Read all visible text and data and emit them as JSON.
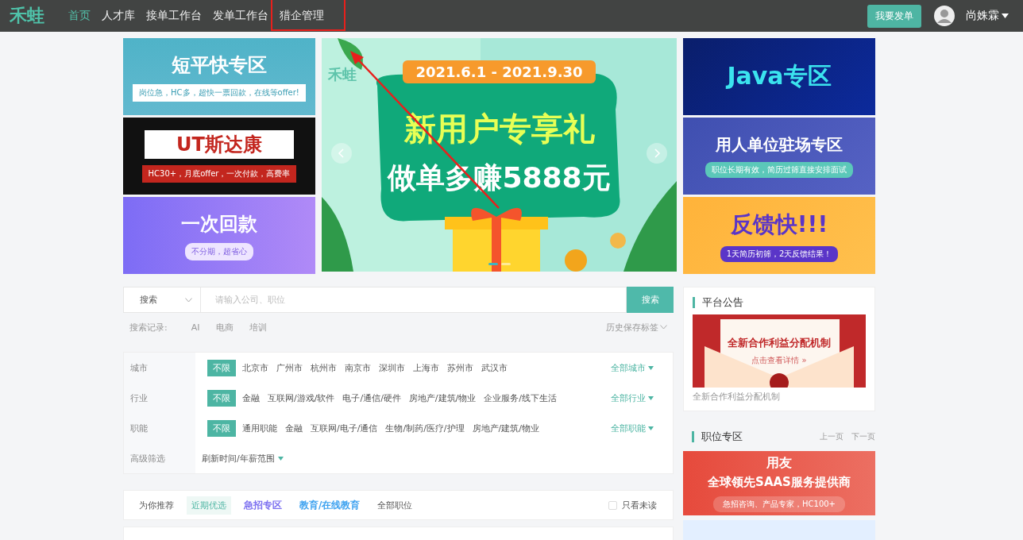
{
  "nav": {
    "logo": "禾蛙",
    "items": [
      {
        "label": "首页",
        "selected": true,
        "annotated": false
      },
      {
        "label": "人才库",
        "selected": false,
        "annotated": false
      },
      {
        "label": "接单工作台",
        "selected": false,
        "annotated": false
      },
      {
        "label": "发单工作台",
        "selected": false,
        "annotated": false
      },
      {
        "label": "猎企管理",
        "selected": false,
        "annotated": true
      }
    ],
    "post_button": "我要发单",
    "user": "尚姝霖"
  },
  "left_banners": [
    {
      "kind": "duanpingkuai",
      "title": "短平快专区",
      "subtitle": "岗位急，HC多，超快一票回款，在线等offer!"
    },
    {
      "kind": "utstarcom",
      "title": "UT斯达康",
      "subtitle": "HC30+，月底offer，一次付款，高费率"
    },
    {
      "kind": "payment",
      "title": "一次回款",
      "subtitle": "不分期，超省心"
    }
  ],
  "carousel": {
    "logo": "禾蛙",
    "date": "2021.6.1 - 2021.9.30",
    "line1": "新用户专享礼",
    "line2": "做单多赚5888元",
    "dots": [
      {
        "selected": true
      },
      {
        "selected": false
      }
    ]
  },
  "right_banners": [
    {
      "kind": "java",
      "title": "Java专区"
    },
    {
      "kind": "onsite",
      "title": "用人单位驻场专区",
      "subtitle": "职位长期有效，简历过筛直接安排面试"
    },
    {
      "kind": "feedback",
      "title": "反馈快!!!",
      "subtitle": "1天简历初筛，2天反馈结果！"
    }
  ],
  "search": {
    "scope": "搜索",
    "placeholder": "请输入公司、职位",
    "button": "搜索"
  },
  "history": {
    "label": "搜索记录:",
    "tags": [
      "AI",
      "电商",
      "培训"
    ],
    "saved": "历史保存标签"
  },
  "filters": [
    {
      "label": "城市",
      "options": [
        {
          "label": "不限",
          "selected": true
        },
        {
          "label": "北京市",
          "selected": false
        },
        {
          "label": "广州市",
          "selected": false
        },
        {
          "label": "杭州市",
          "selected": false
        },
        {
          "label": "南京市",
          "selected": false
        },
        {
          "label": "深圳市",
          "selected": false
        },
        {
          "label": "上海市",
          "selected": false
        },
        {
          "label": "苏州市",
          "selected": false
        },
        {
          "label": "武汉市",
          "selected": false
        }
      ],
      "more": "全部城市"
    },
    {
      "label": "行业",
      "options": [
        {
          "label": "不限",
          "selected": true
        },
        {
          "label": "金融",
          "selected": false
        },
        {
          "label": "互联网/游戏/软件",
          "selected": false
        },
        {
          "label": "电子/通信/硬件",
          "selected": false
        },
        {
          "label": "房地产/建筑/物业",
          "selected": false
        },
        {
          "label": "企业服务/线下生活",
          "selected": false
        }
      ],
      "more": "全部行业"
    },
    {
      "label": "职能",
      "options": [
        {
          "label": "不限",
          "selected": true
        },
        {
          "label": "通用职能",
          "selected": false
        },
        {
          "label": "金融",
          "selected": false
        },
        {
          "label": "互联网/电子/通信",
          "selected": false
        },
        {
          "label": "生物/制药/医疗/护理",
          "selected": false
        },
        {
          "label": "房地产/建筑/物业",
          "selected": false
        }
      ],
      "more": "全部职能"
    }
  ],
  "advanced": {
    "label": "高级筛选",
    "dropdown": "刷新时间/年薪范围"
  },
  "job_tabs": [
    {
      "label": "为你推荐",
      "kind": "plain",
      "selected": false
    },
    {
      "label": "近期优选",
      "kind": "plain",
      "selected": true
    },
    {
      "label": "急招专区",
      "kind": "promo",
      "color": "#7b6ff0",
      "selected": false
    },
    {
      "label": "教育/在线教育",
      "kind": "promo",
      "color": "#3fa3f0",
      "selected": false
    },
    {
      "label": "全部职位",
      "kind": "plain",
      "selected": false
    }
  ],
  "unread_only": {
    "label": "只看未读",
    "checked": false
  },
  "notice": {
    "title": "平台公告",
    "image_title": "全新合作利益分配机制",
    "image_link": "点击查看详情 »",
    "caption": "全新合作利益分配机制"
  },
  "job_zone": {
    "title": "职位专区",
    "prev": "上一页",
    "next": "下一页",
    "banner": {
      "title": "用友",
      "subtitle": "全球领先SAAS服务提供商",
      "tag": "急招咨询、产品专家，HC100+"
    }
  }
}
